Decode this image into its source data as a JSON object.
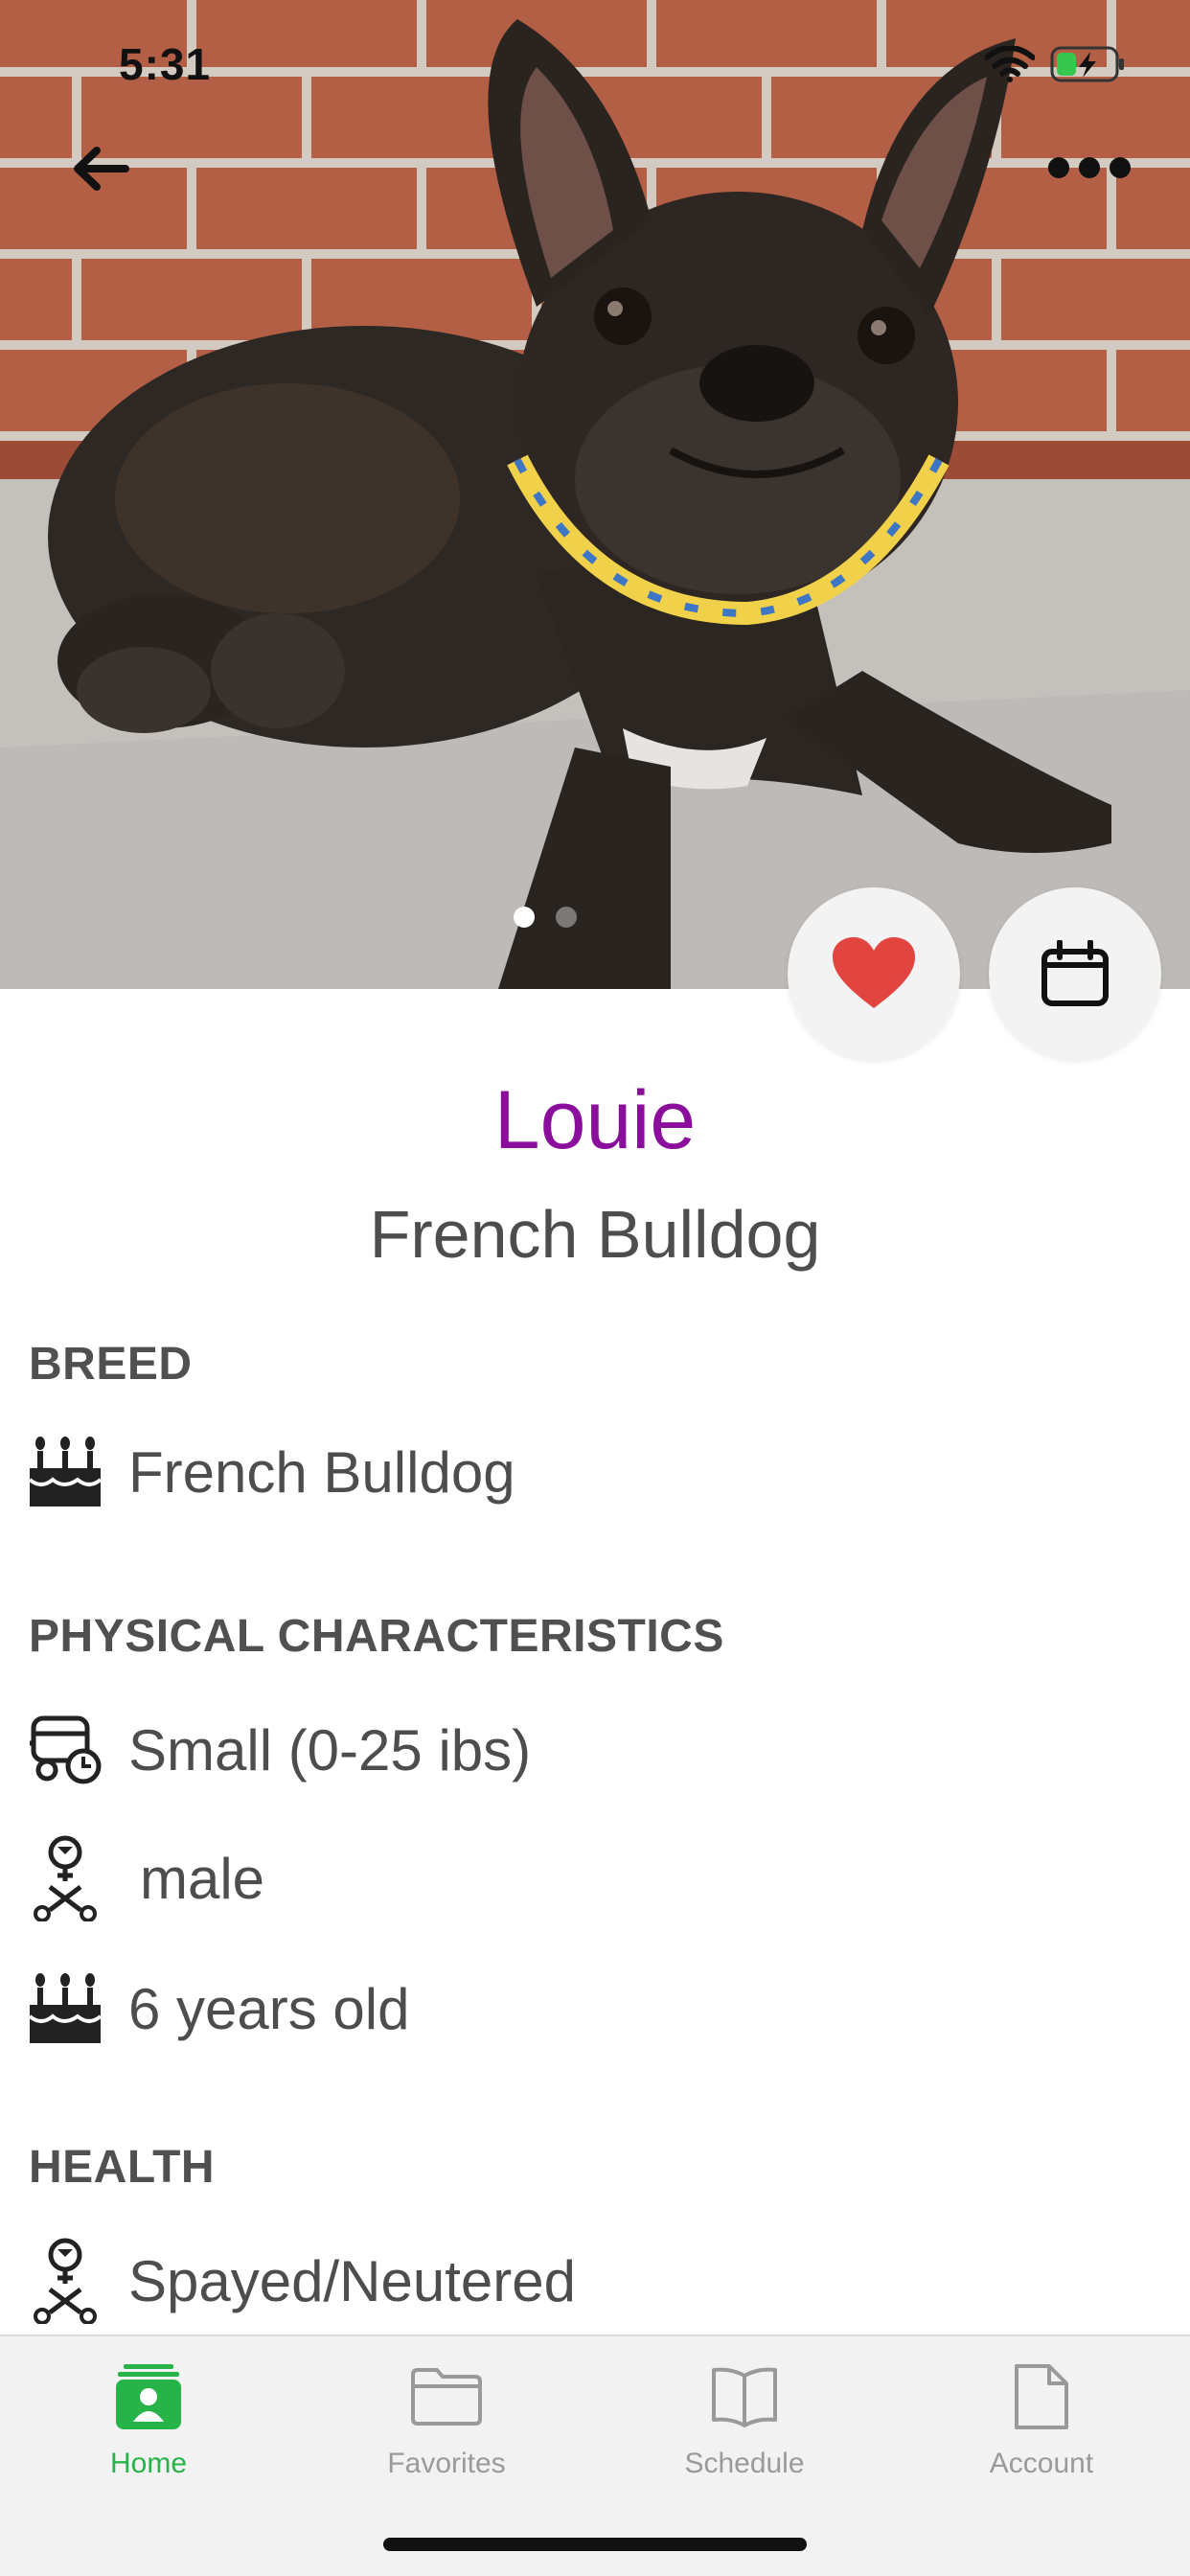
{
  "status_bar": {
    "time": "5:31"
  },
  "photo": {
    "alt_icon": "french-bulldog-photo",
    "page_count": 2,
    "current_page": 1
  },
  "actions": {
    "favorite_icon": "heart-icon",
    "schedule_icon": "calendar-icon",
    "accent_heart": "#e2443f"
  },
  "pet": {
    "name": "Louie",
    "subtitle": "French Bulldog",
    "name_color": "#8b0d9c"
  },
  "sections": {
    "breed": {
      "heading": "BREED",
      "items": [
        {
          "icon": "cake-icon",
          "text": "French Bulldog"
        }
      ]
    },
    "physical": {
      "heading": "PHYSICAL CHARACTERISTICS",
      "items": [
        {
          "icon": "size-icon",
          "text": "Small (0-25 ibs)"
        },
        {
          "icon": "gender-icon",
          "text": "male"
        },
        {
          "icon": "cake-icon",
          "text": "6 years old"
        }
      ]
    },
    "health": {
      "heading": "HEALTH",
      "items": [
        {
          "icon": "neutered-icon",
          "text": "Spayed/Neutered"
        }
      ]
    }
  },
  "tabbar": {
    "active_color": "#26b347",
    "tabs": [
      {
        "label": "Home",
        "icon": "home-profile-icon",
        "active": true
      },
      {
        "label": "Favorites",
        "icon": "folder-icon",
        "active": false
      },
      {
        "label": "Schedule",
        "icon": "book-icon",
        "active": false
      },
      {
        "label": "Account",
        "icon": "document-icon",
        "active": false
      }
    ]
  }
}
